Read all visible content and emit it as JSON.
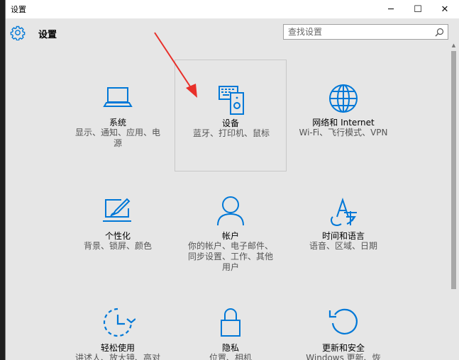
{
  "window": {
    "title": "设置"
  },
  "window_controls": {
    "minimize": "─",
    "maximize": "☐",
    "close": "✕"
  },
  "header": {
    "title": "设置",
    "icon": "gear-icon"
  },
  "search": {
    "placeholder": "查找设置",
    "value": "",
    "icon": "search-icon"
  },
  "accent_color": "#0078d7",
  "tiles": [
    {
      "label": "系统",
      "desc": "显示、通知、应用、电源",
      "icon": "laptop-icon"
    },
    {
      "label": "设备",
      "desc": "蓝牙、打印机、鼠标",
      "icon": "devices-icon",
      "selected": true
    },
    {
      "label": "网络和 Internet",
      "desc": "Wi-Fi、飞行模式、VPN",
      "icon": "globe-icon"
    },
    {
      "label": "个性化",
      "desc": "背景、锁屏、颜色",
      "icon": "personalization-icon"
    },
    {
      "label": "帐户",
      "desc": "你的帐户、电子邮件、同步设置、工作、其他用户",
      "icon": "person-icon"
    },
    {
      "label": "时间和语言",
      "desc": "语音、区域、日期",
      "icon": "time-language-icon"
    },
    {
      "label": "轻松使用",
      "desc": "讲述人、放大镜、高对",
      "icon": "ease-of-access-icon"
    },
    {
      "label": "隐私",
      "desc": "位置、相机",
      "icon": "lock-icon"
    },
    {
      "label": "更新和安全",
      "desc": "Windows 更新、恢",
      "icon": "update-icon"
    }
  ]
}
